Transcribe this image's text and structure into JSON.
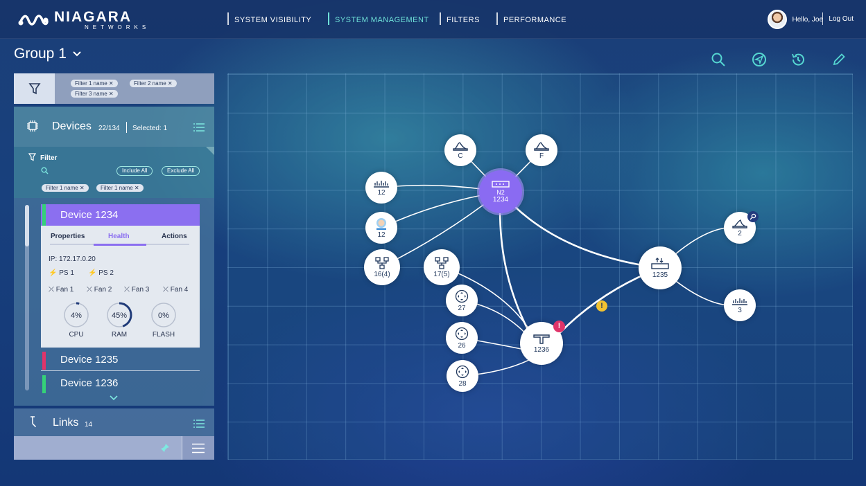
{
  "brand": {
    "name": "NIAGARA",
    "sub": "NETWORKS"
  },
  "nav": [
    {
      "label": "SYSTEM VISIBILITY"
    },
    {
      "label": "SYSTEM MANAGEMENT",
      "active": true
    },
    {
      "label": "FILTERS"
    },
    {
      "label": "PERFORMANCE"
    }
  ],
  "user": {
    "greeting": "Hello, Joe",
    "logout": "Log Out"
  },
  "group": {
    "title": "Group 1"
  },
  "toolbar": {
    "icons": [
      "search-icon",
      "send-icon",
      "history-icon",
      "edit-icon"
    ]
  },
  "filters": {
    "chips": [
      "Filter 1 name",
      "Filter 2 name",
      "Filter 3 name"
    ]
  },
  "devices": {
    "title": "Devices",
    "count": "22/134",
    "selected": "Selected: 1",
    "filter_label": "Filter",
    "include_all": "Include All",
    "exclude_all": "Exclude All",
    "filter_chips": [
      "Filter 1 name",
      "Filter 1 name"
    ],
    "selected_device": {
      "name": "Device 1234",
      "tabs": [
        "Properties",
        "Health",
        "Actions"
      ],
      "active_tab": "Health",
      "ip": "IP: 172.17.0.20",
      "power": [
        "PS 1",
        "PS 2"
      ],
      "fans": [
        "Fan 1",
        "Fan 2",
        "Fan 3",
        "Fan 4"
      ],
      "gauges": [
        {
          "label": "CPU",
          "value": "4%",
          "fraction": 0.04
        },
        {
          "label": "RAM",
          "value": "45%",
          "fraction": 0.45
        },
        {
          "label": "FLASH",
          "value": "0%",
          "fraction": 0
        }
      ]
    },
    "others": [
      {
        "name": "Device 1235",
        "status_color": "#e0346a"
      },
      {
        "name": "Device 1236",
        "status_color": "#35d178"
      }
    ]
  },
  "links": {
    "title": "Links",
    "count": "14"
  },
  "topology": {
    "nodes": [
      {
        "id": "C",
        "label": "C",
        "icon": "fin-icon"
      },
      {
        "id": "F",
        "label": "F",
        "icon": "fin-icon"
      },
      {
        "id": "N2",
        "label1": "N2",
        "label2": "1234",
        "icon": "switch-icon",
        "selected": true
      },
      {
        "id": "12a",
        "label": "12",
        "icon": "port-icon"
      },
      {
        "id": "12b",
        "label": "12",
        "icon": "baby-icon"
      },
      {
        "id": "16",
        "label": "16(4)",
        "icon": "topology-icon"
      },
      {
        "id": "17",
        "label": "17(5)",
        "icon": "topology-icon"
      },
      {
        "id": "27",
        "label": "27",
        "icon": "arrows-icon"
      },
      {
        "id": "26",
        "label": "26",
        "icon": "arrows-icon"
      },
      {
        "id": "28",
        "label": "28",
        "icon": "arrows-icon"
      },
      {
        "id": "1236",
        "label": "1236",
        "icon": "tap-icon",
        "alert": "!"
      },
      {
        "id": "1235",
        "label": "1235",
        "icon": "transfer-icon"
      },
      {
        "id": "2",
        "label": "2",
        "icon": "fin-icon"
      },
      {
        "id": "3",
        "label": "3",
        "icon": "port-icon"
      }
    ],
    "link_warning": "!"
  }
}
